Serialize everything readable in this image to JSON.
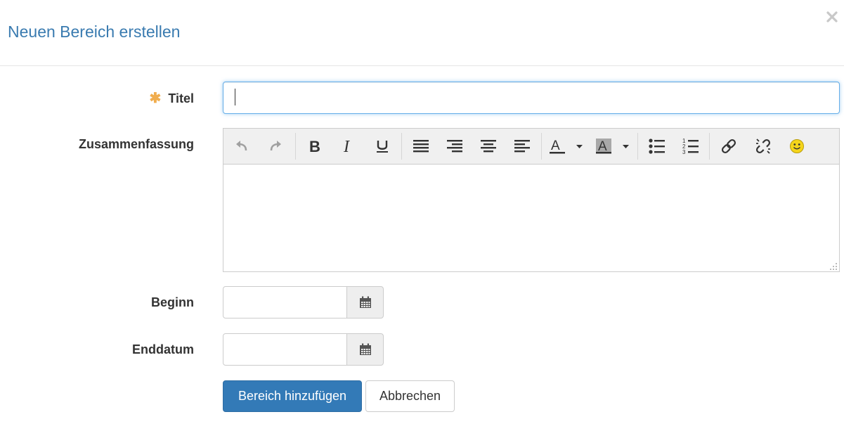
{
  "dialog": {
    "title": "Neuen Bereich erstellen",
    "close_icon": "close-icon"
  },
  "form": {
    "title_label": "Titel",
    "required_marker": "✱",
    "title_value": "",
    "summary_label": "Zusammenfassung",
    "start_label": "Beginn",
    "start_value": "",
    "end_label": "Enddatum",
    "end_value": ""
  },
  "editor": {
    "toolbar_icons": [
      "undo-icon",
      "redo-icon",
      "bold-icon",
      "italic-icon",
      "underline-icon",
      "align-justify-icon",
      "align-right-icon",
      "align-center-icon",
      "align-left-icon",
      "text-color-icon",
      "background-color-icon",
      "bullet-list-icon",
      "numbered-list-icon",
      "link-icon",
      "unlink-icon",
      "emoticon-icon"
    ],
    "content": ""
  },
  "actions": {
    "submit_label": "Bereich hinzufügen",
    "cancel_label": "Abbrechen"
  },
  "colors": {
    "accent": "#337ab7",
    "title": "#3a7bb0",
    "required": "#f0ad4e",
    "focus": "#66afe9"
  }
}
